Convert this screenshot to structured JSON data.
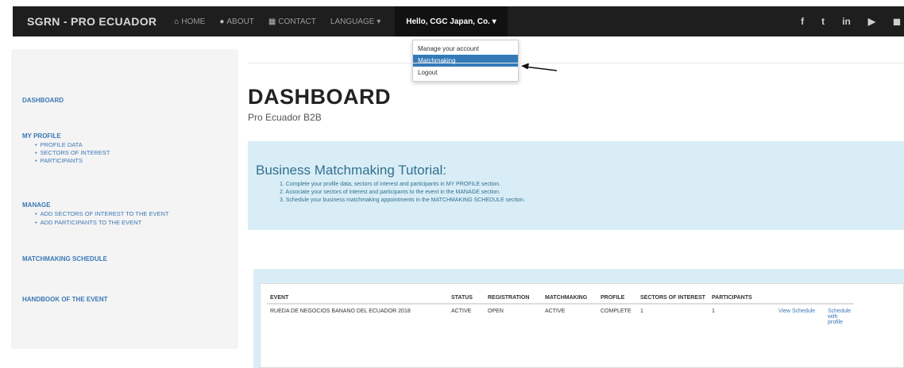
{
  "navbar": {
    "brand": "SGRN - PRO ECUADOR",
    "items": [
      {
        "icon": "home-icon",
        "glyph": "⌂",
        "label": "HOME"
      },
      {
        "icon": "info-icon",
        "glyph": "●",
        "label": "ABOUT"
      },
      {
        "icon": "contact-icon",
        "glyph": "▦",
        "label": "CONTACT"
      },
      {
        "icon": "language-icon",
        "glyph": "",
        "label": "LANGUAGE ▾"
      }
    ],
    "user_label": "Hello, CGC Japan, Co. ▾",
    "social": [
      {
        "icon": "facebook-icon",
        "glyph": "f"
      },
      {
        "icon": "twitter-icon",
        "glyph": "t"
      },
      {
        "icon": "linkedin-icon",
        "glyph": "in"
      },
      {
        "icon": "youtube-icon",
        "glyph": "▶"
      },
      {
        "icon": "flickr-icon",
        "glyph": "◼"
      }
    ]
  },
  "dropdown": {
    "items": [
      "Manage your account",
      "Matchmaking",
      "Logout"
    ],
    "active_index": 1
  },
  "sidebar": {
    "dashboard": "DASHBOARD",
    "my_profile": "MY PROFILE",
    "profile_items": [
      "PROFILE DATA",
      "SECTORS OF INTEREST",
      "PARTICIPANTS"
    ],
    "manage": "MANAGE",
    "manage_items": [
      "ADD SECTORS OF INTEREST TO THE EVENT",
      "ADD PARTICIPANTS TO THE EVENT"
    ],
    "matchmaking_schedule": "MATCHMAKING SCHEDULE",
    "handbook": "HANDBOOK OF THE EVENT"
  },
  "main": {
    "title": "DASHBOARD",
    "subtitle": "Pro Ecuador B2B"
  },
  "tutorial": {
    "title": "Business Matchmaking Tutorial:",
    "steps": [
      "1. Complete your profile data, sectors of interest and participants in MY PROFILE section.",
      "2. Associate your sectors of interest and participants to the event in the MANAGE section.",
      "3. Schedule your business matchmaking appointments in the MATCHMAKING SCHEDULE section."
    ]
  },
  "table": {
    "headers": [
      "EVENT",
      "STATUS",
      "REGISTRATION",
      "MATCHMAKING",
      "PROFILE",
      "SECTORS OF INTEREST",
      "PARTICIPANTS",
      "",
      ""
    ],
    "rows": [
      {
        "event": "RUEDA DE NEGOCIOS BANANO DEL ECUADOR 2018",
        "status": "ACTIVE",
        "registration": "OPEN",
        "matchmaking": "ACTIVE",
        "profile": "COMPLETE",
        "sectors": "1",
        "participants": "1",
        "view_link": "View Schedule",
        "schedule_link": "Schedule with profile"
      }
    ]
  },
  "colors": {
    "navbar_bg": "#1e1e1e",
    "link": "#3b78b4",
    "info_bg": "#d9edf7",
    "info_text": "#31708f",
    "dropdown_active": "#337ab7"
  }
}
